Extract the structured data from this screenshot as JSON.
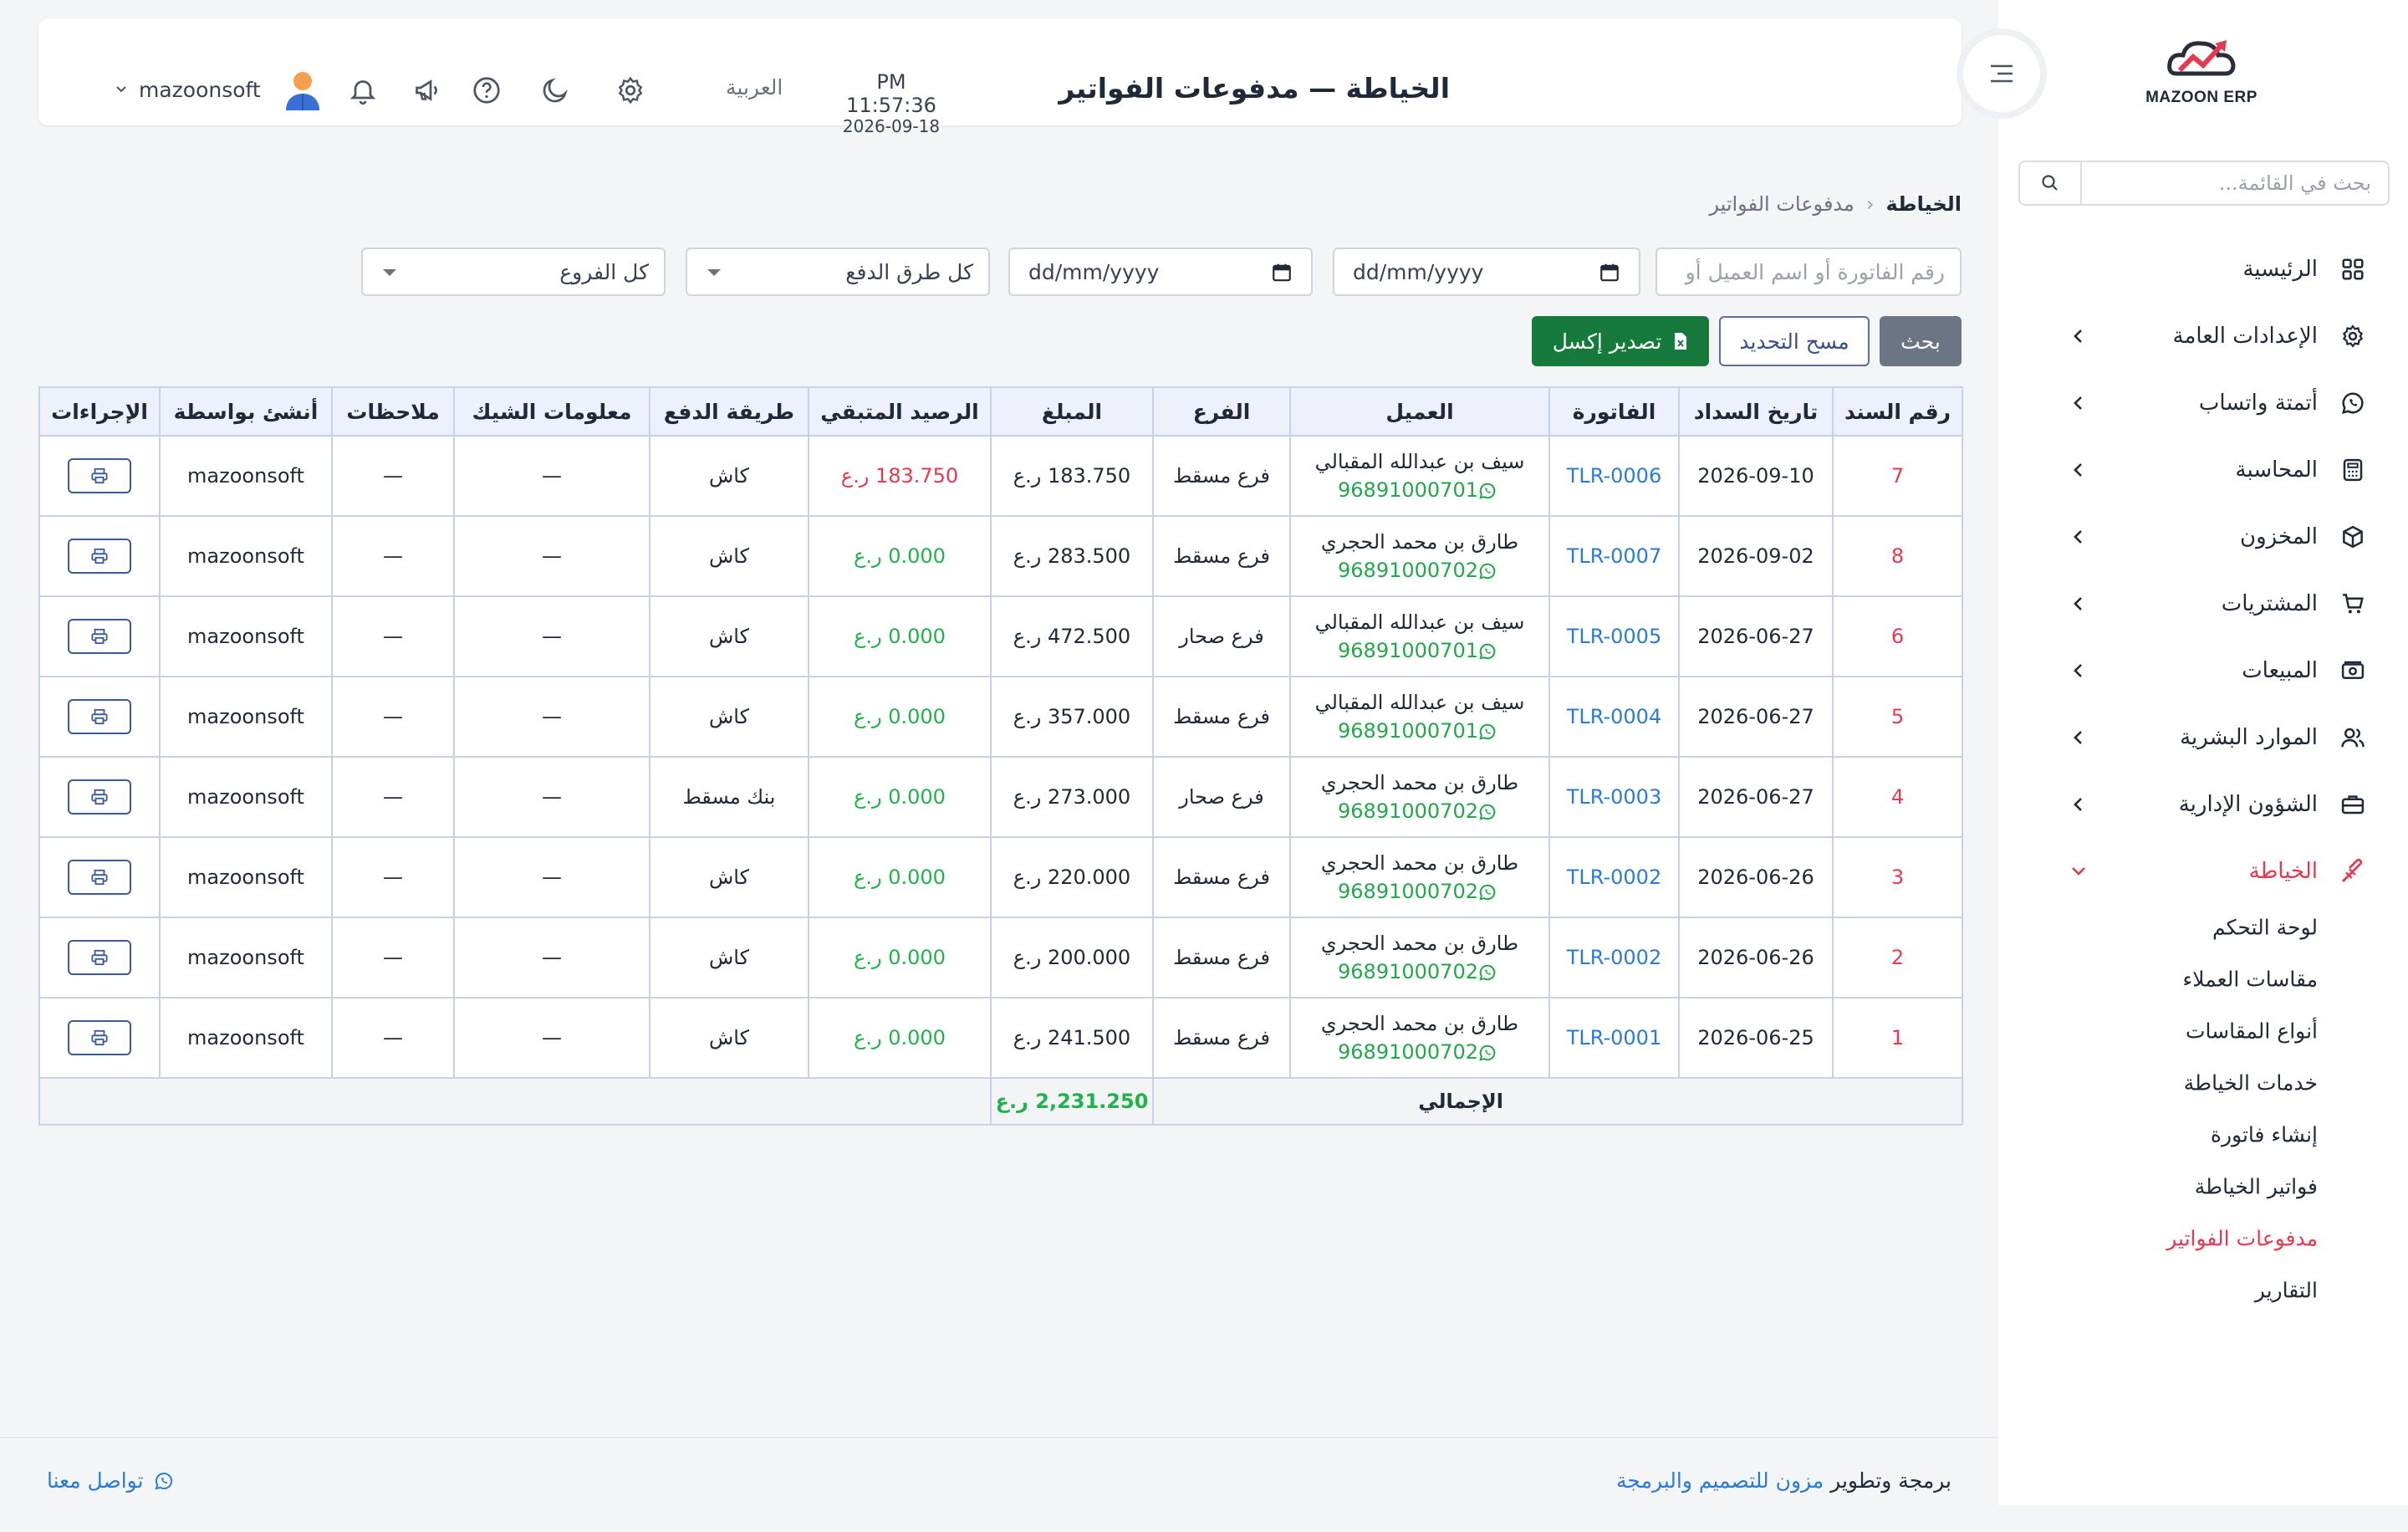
{
  "brand": {
    "logo_text": "MAZOON ERP"
  },
  "sidebar": {
    "search_placeholder": "بحث في القائمة...",
    "items": [
      {
        "label": "الرئيسية",
        "icon": "grid-icon"
      },
      {
        "label": "الإعدادات العامة",
        "icon": "gear-icon"
      },
      {
        "label": "أتمتة واتساب",
        "icon": "whatsapp-icon"
      },
      {
        "label": "المحاسبة",
        "icon": "calculator-icon"
      },
      {
        "label": "المخزون",
        "icon": "box-icon"
      },
      {
        "label": "المشتريات",
        "icon": "cart-icon"
      },
      {
        "label": "المبيعات",
        "icon": "cash-icon"
      },
      {
        "label": "الموارد البشرية",
        "icon": "users-icon"
      },
      {
        "label": "الشؤون الإدارية",
        "icon": "briefcase-icon"
      },
      {
        "label": "الخياطة",
        "icon": "tailoring-icon"
      }
    ],
    "sub_items": [
      {
        "label": "لوحة التحكم"
      },
      {
        "label": "مقاسات العملاء"
      },
      {
        "label": "أنواع المقاسات"
      },
      {
        "label": "خدمات الخياطة"
      },
      {
        "label": "إنشاء فاتورة"
      },
      {
        "label": "فواتير الخياطة"
      },
      {
        "label": "مدفوعات الفواتير"
      },
      {
        "label": "التقارير"
      }
    ],
    "accent_color": "#e53950"
  },
  "header": {
    "title": "الخياطة — مدفوعات الفواتير",
    "time": "PM 11:57:36",
    "date": "2026-09-18",
    "language": "العربية",
    "username": "mazoonsoft"
  },
  "breadcrumb": {
    "parent": "الخياطة",
    "current": "مدفوعات الفواتير"
  },
  "filters": {
    "search_placeholder": "رقم الفاتورة أو اسم العميل أو",
    "date_from": "dd/mm/yyyy",
    "date_to": "dd/mm/yyyy",
    "payment_method": "كل طرق الدفع",
    "branch": "كل الفروع"
  },
  "buttons": {
    "search": "بحث",
    "clear": "مسح التحديد",
    "export": "تصدير إكسل"
  },
  "table": {
    "headers": [
      "رقم السند",
      "تاريخ السداد",
      "الفاتورة",
      "العميل",
      "الفرع",
      "المبلغ",
      "الرصيد المتبقي",
      "طريقة الدفع",
      "معلومات الشيك",
      "ملاحظات",
      "أنشئ بواسطة",
      "الإجراءات"
    ],
    "rows": [
      {
        "no": "7",
        "date": "2026-09-10",
        "invoice": "TLR-0006",
        "customer": "سيف بن عبدالله المقبالي",
        "phone": "96891000701",
        "branch": "فرع مسقط",
        "amount": "183.750 ر.ع",
        "balance": "183.750 ر.ع",
        "balance_status": "due",
        "method": "كاش",
        "cheque": "—",
        "notes": "—",
        "by": "mazoonsoft"
      },
      {
        "no": "8",
        "date": "2026-09-02",
        "invoice": "TLR-0007",
        "customer": "طارق بن محمد الحجري",
        "phone": "96891000702",
        "branch": "فرع مسقط",
        "amount": "283.500 ر.ع",
        "balance": "0.000 ر.ع",
        "balance_status": "paid",
        "method": "كاش",
        "cheque": "—",
        "notes": "—",
        "by": "mazoonsoft"
      },
      {
        "no": "6",
        "date": "2026-06-27",
        "invoice": "TLR-0005",
        "customer": "سيف بن عبدالله المقبالي",
        "phone": "96891000701",
        "branch": "فرع صحار",
        "amount": "472.500 ر.ع",
        "balance": "0.000 ر.ع",
        "balance_status": "paid",
        "method": "كاش",
        "cheque": "—",
        "notes": "—",
        "by": "mazoonsoft"
      },
      {
        "no": "5",
        "date": "2026-06-27",
        "invoice": "TLR-0004",
        "customer": "سيف بن عبدالله المقبالي",
        "phone": "96891000701",
        "branch": "فرع مسقط",
        "amount": "357.000 ر.ع",
        "balance": "0.000 ر.ع",
        "balance_status": "paid",
        "method": "كاش",
        "cheque": "—",
        "notes": "—",
        "by": "mazoonsoft"
      },
      {
        "no": "4",
        "date": "2026-06-27",
        "invoice": "TLR-0003",
        "customer": "طارق بن محمد الحجري",
        "phone": "96891000702",
        "branch": "فرع صحار",
        "amount": "273.000 ر.ع",
        "balance": "0.000 ر.ع",
        "balance_status": "paid",
        "method": "بنك مسقط",
        "cheque": "—",
        "notes": "—",
        "by": "mazoonsoft"
      },
      {
        "no": "3",
        "date": "2026-06-26",
        "invoice": "TLR-0002",
        "customer": "طارق بن محمد الحجري",
        "phone": "96891000702",
        "branch": "فرع مسقط",
        "amount": "220.000 ر.ع",
        "balance": "0.000 ر.ع",
        "balance_status": "paid",
        "method": "كاش",
        "cheque": "—",
        "notes": "—",
        "by": "mazoonsoft"
      },
      {
        "no": "2",
        "date": "2026-06-26",
        "invoice": "TLR-0002",
        "customer": "طارق بن محمد الحجري",
        "phone": "96891000702",
        "branch": "فرع مسقط",
        "amount": "200.000 ر.ع",
        "balance": "0.000 ر.ع",
        "balance_status": "paid",
        "method": "كاش",
        "cheque": "—",
        "notes": "—",
        "by": "mazoonsoft"
      },
      {
        "no": "1",
        "date": "2026-06-25",
        "invoice": "TLR-0001",
        "customer": "طارق بن محمد الحجري",
        "phone": "96891000702",
        "branch": "فرع مسقط",
        "amount": "241.500 ر.ع",
        "balance": "0.000 ر.ع",
        "balance_status": "paid",
        "method": "كاش",
        "cheque": "—",
        "notes": "—",
        "by": "mazoonsoft"
      }
    ],
    "total_label": "الإجمالي",
    "total_value": "2,231.250 ر.ع"
  },
  "footer": {
    "credit_prefix": "برمجة وتطوير",
    "credit_link": "مزون للتصميم والبرمجة",
    "contact": "تواصل معنا"
  },
  "colors": {
    "export_green": "#157a3c",
    "link_blue": "#2b7bd6",
    "paid_green": "#22b14c",
    "due_red": "#e53950"
  }
}
